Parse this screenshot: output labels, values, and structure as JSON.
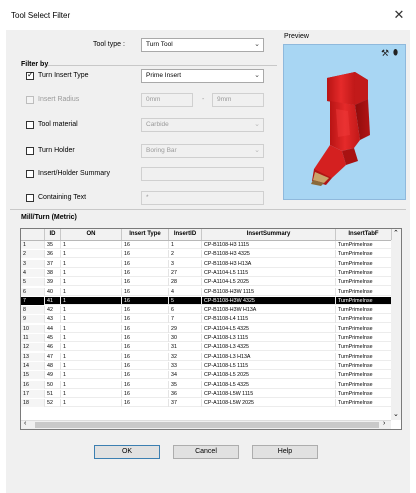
{
  "window": {
    "title": "Tool Select Filter",
    "close_glyph": "✕"
  },
  "tool_type": {
    "label": "Tool type :",
    "value": "Turn Tool"
  },
  "preview": {
    "label": "Preview"
  },
  "filter_by": {
    "heading": "Filter by",
    "turn_insert_type": {
      "label": "Turn Insert Type",
      "checked": true,
      "value": "Prime Insert"
    },
    "insert_radius": {
      "label": "Insert Radius",
      "checked": false,
      "enabled": false,
      "min": "0mm",
      "separator": "-",
      "max": "9mm"
    },
    "tool_material": {
      "label": "Tool material",
      "checked": false,
      "value": "Carbide"
    },
    "turn_holder": {
      "label": "Turn Holder",
      "checked": false,
      "value": "Boring Bar"
    },
    "insert_holder_summary": {
      "label": "Insert/Holder Summary",
      "checked": false,
      "value": ""
    },
    "containing_text": {
      "label": "Containing Text",
      "checked": false,
      "value": "*"
    }
  },
  "table_section": {
    "heading": "Mill/Turn (Metric)"
  },
  "table": {
    "columns": [
      "",
      "ID",
      "ON",
      "Insert Type",
      "InsertID",
      "InsertSummary",
      "InsertTabF"
    ],
    "selected_row": 7,
    "rows": [
      [
        "1",
        "35",
        "1",
        "16",
        "1",
        "CP-B1108-H3 1115",
        "TurnPrimeInse"
      ],
      [
        "2",
        "36",
        "1",
        "16",
        "2",
        "CP-B1108-H3 4325",
        "TurnPrimeInse"
      ],
      [
        "3",
        "37",
        "1",
        "16",
        "3",
        "CP-B1108-H3 H13A",
        "TurnPrimeInse"
      ],
      [
        "4",
        "38",
        "1",
        "16",
        "27",
        "CP-A1104-L5 1115",
        "TurnPrimeInse"
      ],
      [
        "5",
        "39",
        "1",
        "16",
        "28",
        "CP-A1104-L5 2025",
        "TurnPrimeInse"
      ],
      [
        "6",
        "40",
        "1",
        "16",
        "4",
        "CP-B1108-H3W 1115",
        "TurnPrimeInse"
      ],
      [
        "7",
        "41",
        "1",
        "16",
        "5",
        "CP-B1108-H3W 4325",
        "TurnPrimeInse"
      ],
      [
        "8",
        "42",
        "1",
        "16",
        "6",
        "CP-B1108-H3W H13A",
        "TurnPrimeInse"
      ],
      [
        "9",
        "43",
        "1",
        "16",
        "7",
        "CP-B1108-L4 1115",
        "TurnPrimeInse"
      ],
      [
        "10",
        "44",
        "1",
        "16",
        "29",
        "CP-A1104-L5 4325",
        "TurnPrimeInse"
      ],
      [
        "11",
        "45",
        "1",
        "16",
        "30",
        "CP-A1108-L3 1115",
        "TurnPrimeInse"
      ],
      [
        "12",
        "46",
        "1",
        "16",
        "31",
        "CP-A1108-L3 4325",
        "TurnPrimeInse"
      ],
      [
        "13",
        "47",
        "1",
        "16",
        "32",
        "CP-A1108-L3 H13A",
        "TurnPrimeInse"
      ],
      [
        "14",
        "48",
        "1",
        "16",
        "33",
        "CP-A1108-L5 1115",
        "TurnPrimeInse"
      ],
      [
        "15",
        "49",
        "1",
        "16",
        "34",
        "CP-A1108-L5 2025",
        "TurnPrimeInse"
      ],
      [
        "16",
        "50",
        "1",
        "16",
        "35",
        "CP-A1108-L5 4325",
        "TurnPrimeInse"
      ],
      [
        "17",
        "51",
        "1",
        "16",
        "36",
        "CP-A1108-L5W 1115",
        "TurnPrimeInse"
      ],
      [
        "18",
        "52",
        "1",
        "16",
        "37",
        "CP-A1108-L5W 2025",
        "TurnPrimeInse"
      ]
    ]
  },
  "buttons": {
    "ok": "OK",
    "cancel": "Cancel",
    "help": "Help"
  },
  "icons": {
    "preview_tool_icon": "tool-icon",
    "preview_pin_icon": "pin-icon"
  },
  "colors": {
    "preview_bg": "#a8d6f3",
    "tool_red": "#d81e1e",
    "selection": "#000000"
  }
}
